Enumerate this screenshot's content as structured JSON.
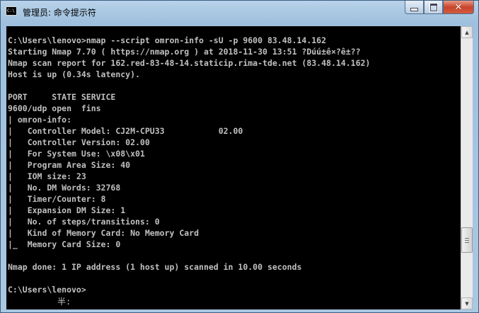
{
  "window": {
    "title": "管理员: 命令提示符",
    "icon_label": "C:\\"
  },
  "console": {
    "lines": [
      "C:\\Users\\lenovo>nmap --script omron-info -sU -p 9600 83.48.14.162",
      "Starting Nmap 7.70 ( https://nmap.org ) at 2018-11-30 13:51 ?Dúú±ê×?ê±??",
      "Nmap scan report for 162.red-83-48-14.staticip.rima-tde.net (83.48.14.162)",
      "Host is up (0.34s latency).",
      "",
      "PORT     STATE SERVICE",
      "9600/udp open  fins",
      "| omron-info:",
      "|   Controller Model: CJ2M-CPU33           02.00",
      "|   Controller Version: 02.00",
      "|   For System Use: \\x08\\x01",
      "|   Program Area Size: 40",
      "|   IOM size: 23",
      "|   No. DM Words: 32768",
      "|   Timer/Counter: 8",
      "|   Expansion DM Size: 1",
      "|   No. of steps/transitions: 0",
      "|   Kind of Memory Card: No Memory Card",
      "|_  Memory Card Size: 0",
      "",
      "Nmap done: 1 IP address (1 host up) scanned in 10.00 seconds",
      "",
      "C:\\Users\\lenovo>"
    ],
    "ime_status": "半:"
  }
}
